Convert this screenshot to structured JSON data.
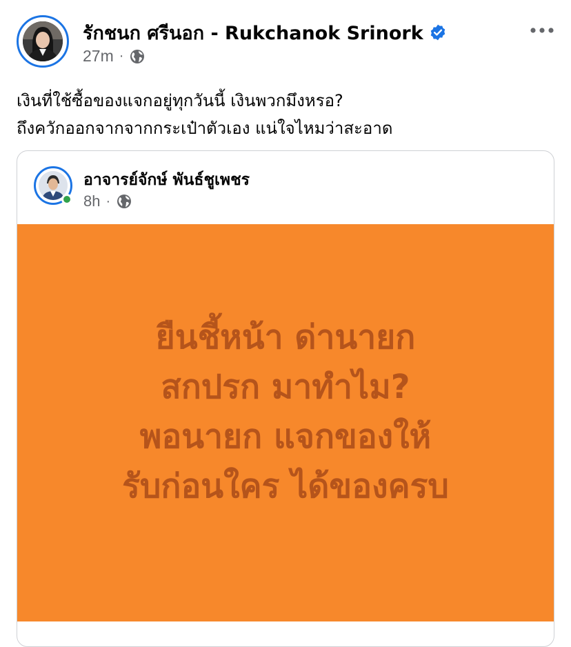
{
  "post": {
    "author": "รักชนก ศรีนอก - Rukchanok Srinork",
    "verified": true,
    "time": "27m",
    "separator": "·",
    "audience_icon": "globe-icon",
    "more_icon": "more-options-icon",
    "text_lines": [
      "เงินที่ใช้ซื้อของแจกอยู่ทุกวันนี้ เงินพวกมึงหรอ?",
      "ถึงควักออกจากจากกระเป๋าตัวเอง แน่ใจไหมว่าสะอาด"
    ]
  },
  "shared_post": {
    "author": "อาจารย์จักษ์ พันธ์ชูเพชร",
    "time": "8h",
    "separator": "·",
    "audience_icon": "globe-icon",
    "online": true,
    "image": {
      "background": "#f7882b",
      "text_color": "#b5541b",
      "lines": [
        "ยืนชี้หน้า ด่านายก",
        "สกปรก มาทำไม?",
        "พอนายก แจกของให้",
        "รับก่อนใคร ได้ของครบ"
      ]
    }
  },
  "colors": {
    "accent": "#1b74e4",
    "secondary_text": "#65676b",
    "online": "#31a24c",
    "border": "#ced0d4"
  }
}
